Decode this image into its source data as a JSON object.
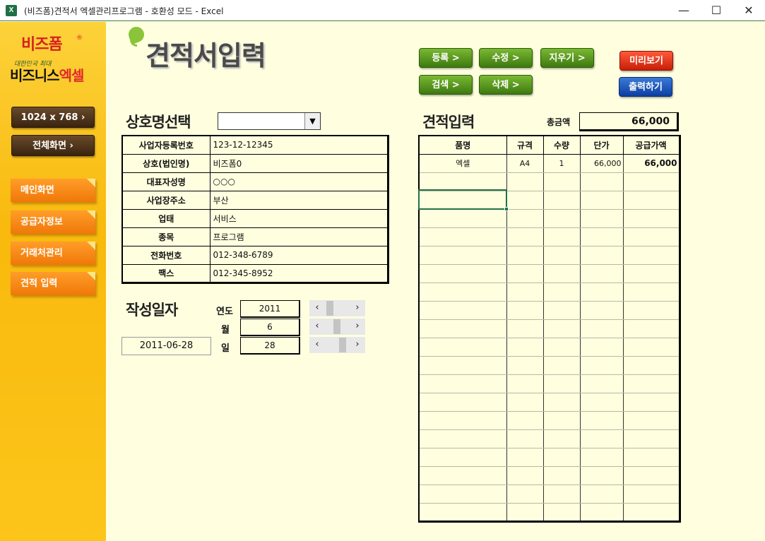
{
  "window": {
    "title": "(비즈폼)견적서 엑셀관리프로그램  -  호환성 모드 - Excel",
    "icon_label": "X",
    "minimize": "—",
    "maximize": "☐",
    "close": "✕"
  },
  "sidebar": {
    "logo_top": "비즈폼",
    "logo_reg": "®",
    "logo_sub": "대한민국 최대",
    "logo_main_a": "비즈니스",
    "logo_main_b": "엑셀",
    "resolution_btn": "1024 x 768  ›",
    "fullscreen_btn": "전체화면  ›",
    "nav": [
      "메인화면",
      "공급자정보",
      "거래처관리",
      "견적 입력"
    ]
  },
  "header": {
    "title": "견적서입력",
    "buttons": {
      "register": "등록 >",
      "edit": "수정 >",
      "clear": "지우기 >",
      "search": "검색 >",
      "delete": "삭제 >",
      "preview": "미리보기",
      "print": "출력하기"
    }
  },
  "company": {
    "section_title": "상호명선택",
    "combo_value": "",
    "combo_arrow": "▼",
    "rows": [
      {
        "label": "사업자등록번호",
        "value": "123-12-12345"
      },
      {
        "label": "상호(법인명)",
        "value": "비즈폼0"
      },
      {
        "label": "대표자성명",
        "value": "○○○"
      },
      {
        "label": "사업장주소",
        "value": "부산"
      },
      {
        "label": "업태",
        "value": "서비스"
      },
      {
        "label": "종목",
        "value": "프로그램"
      },
      {
        "label": "전화번호",
        "value": "012-348-6789"
      },
      {
        "label": "팩스",
        "value": "012-345-8952"
      }
    ]
  },
  "date": {
    "section_title": "작성일자",
    "year_label": "연도",
    "month_label": "월",
    "day_label": "일",
    "year": "2011",
    "month": "6",
    "day": "28",
    "full": "2011-06-28",
    "spin_left": "‹",
    "spin_right": "›"
  },
  "estimate": {
    "section_title": "견적입력",
    "total_label": "총금액",
    "total_value": "66,000",
    "columns": [
      "품명",
      "규격",
      "수량",
      "단가",
      "공급가액"
    ],
    "rows": [
      [
        "엑셀",
        "A4",
        "1",
        "66,000",
        "66,000"
      ]
    ],
    "empty_rows": 19
  }
}
